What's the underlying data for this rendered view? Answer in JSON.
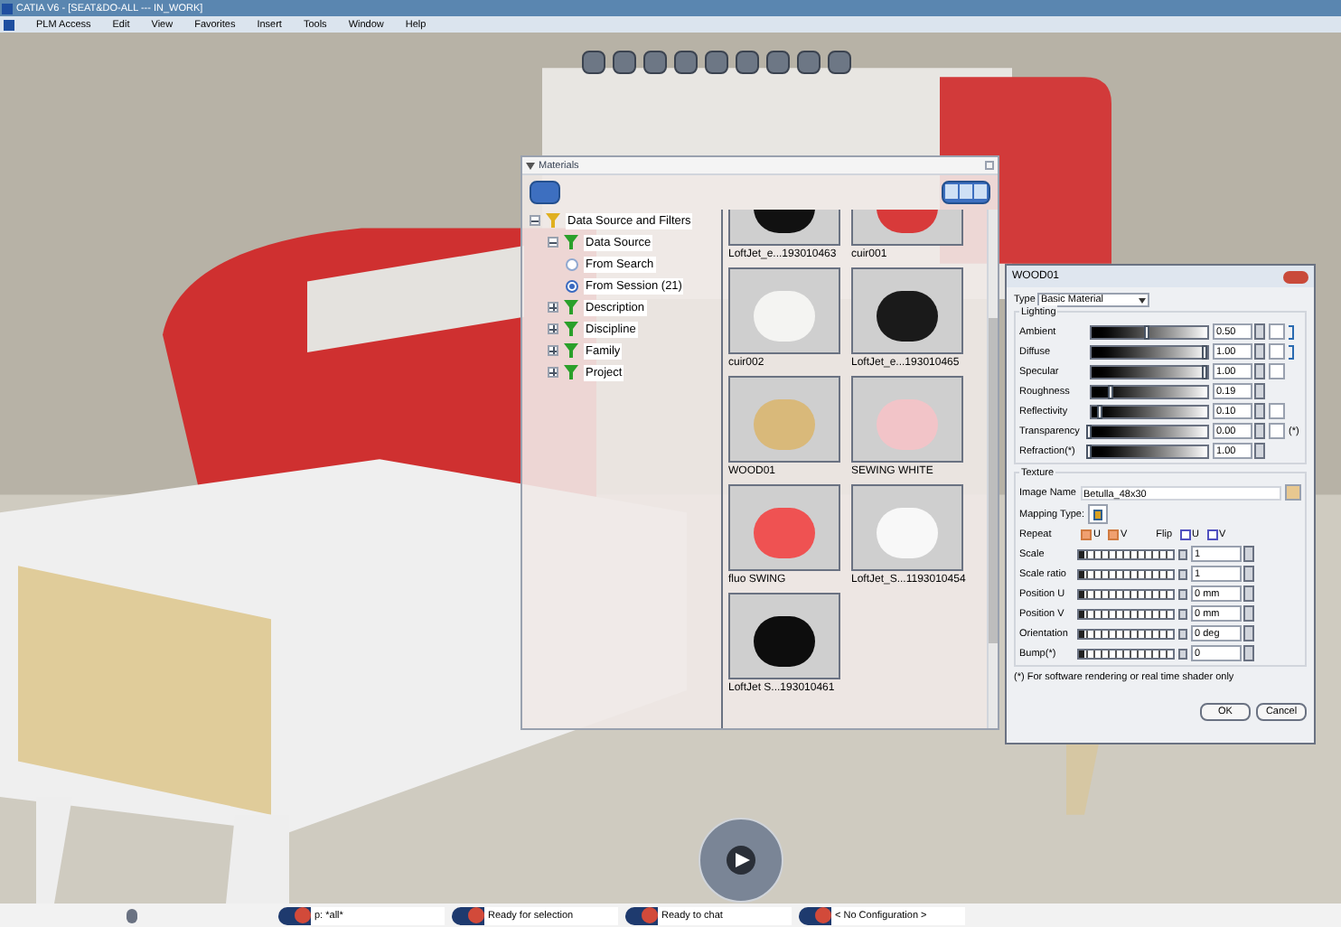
{
  "window": {
    "title": "CATIA V6 - [SEAT&DO-ALL --- IN_WORK]"
  },
  "menu": [
    "PLM Access",
    "Edit",
    "View",
    "Favorites",
    "Insert",
    "Tools",
    "Window",
    "Help"
  ],
  "materials": {
    "title": "Materials",
    "tree": {
      "label": "Data Source and Filters",
      "expanded": true,
      "children": [
        {
          "label": "Data Source",
          "expanded": true,
          "children": [
            {
              "label": "From Search",
              "kind": "radio",
              "selected": false
            },
            {
              "label": "From Session (21)",
              "kind": "radio",
              "selected": true
            }
          ]
        },
        {
          "label": "Description",
          "expanded": false
        },
        {
          "label": "Discipline",
          "expanded": false
        },
        {
          "label": "Family",
          "expanded": false
        },
        {
          "label": "Project",
          "expanded": false
        }
      ]
    },
    "thumbnails": [
      {
        "label": "LoftJet_e...193010463",
        "color": "#111111"
      },
      {
        "label": "cuir001",
        "color": "#d83a3a"
      },
      {
        "label": "cuir002",
        "color": "#f4f4f2"
      },
      {
        "label": "LoftJet_e...193010465",
        "color": "#1a1a1a"
      },
      {
        "label": "WOOD01",
        "color": "#d9b97a"
      },
      {
        "label": "SEWING WHITE",
        "color": "#f2c4c8"
      },
      {
        "label": "fluo SWING",
        "color": "#ef5252"
      },
      {
        "label": "LoftJet_S...1193010454",
        "color": "#f8f8f8"
      },
      {
        "label": "LoftJet S...193010461",
        "color": "#0d0d0d"
      }
    ]
  },
  "dialog": {
    "title": "WOOD01",
    "type_label": "Type",
    "type": "Basic Material",
    "lighting_title": "Lighting",
    "lighting": [
      {
        "label": "Ambient",
        "level": 0.5,
        "value": "0.50",
        "more": true
      },
      {
        "label": "Diffuse",
        "level": 1,
        "value": "1.00",
        "more": true
      },
      {
        "label": "Specular",
        "level": 1,
        "value": "1.00",
        "more": true
      },
      {
        "label": "Roughness",
        "level": 0.19,
        "value": "0.19",
        "more": false
      },
      {
        "label": "Reflectivity",
        "level": 0.1,
        "value": "0.10",
        "more": true
      },
      {
        "label": "Transparency",
        "level": 0,
        "value": "0.00",
        "more": true,
        "note": "(*)"
      },
      {
        "label": "Refraction(*)",
        "level": 0,
        "value": "1.00",
        "more": false
      }
    ],
    "texture_title": "Texture",
    "image_label": "Image Name",
    "image_name": "Betulla_48x30",
    "mapping_label": "Mapping Type:",
    "repeat_label": "Repeat",
    "repeat": [
      {
        "label": "U",
        "checked": true
      },
      {
        "label": "V",
        "checked": true
      }
    ],
    "flip_label": "Flip",
    "flip": [
      {
        "label": "U",
        "checked": false
      },
      {
        "label": "V",
        "checked": false
      }
    ],
    "params": [
      {
        "label": "Scale",
        "value": "1",
        "level": 0
      },
      {
        "label": "Scale ratio",
        "value": "1",
        "level": 0
      },
      {
        "label": "Position U",
        "value": "0 mm",
        "level": 0
      },
      {
        "label": "Position V",
        "value": "0 mm",
        "level": 0
      },
      {
        "label": "Orientation",
        "value": "0 deg",
        "level": 0
      },
      {
        "label": "Bump(*)",
        "value": "0",
        "level": 0
      }
    ],
    "footnote": "(*) For software rendering or real time shader only",
    "buttons": [
      "OK",
      "Cancel"
    ]
  },
  "status_bar": [
    "p: *all*",
    "Ready for selection",
    "Ready to chat",
    "< No Configuration >"
  ]
}
